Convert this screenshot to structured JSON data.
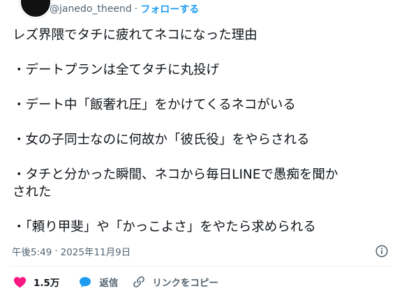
{
  "author": {
    "handle": "@janedo_theend",
    "separator": "·",
    "follow_label": "フォローする"
  },
  "tweet": {
    "lines": [
      "レズ界隈でタチに疲れてネコになった理由",
      "",
      "・デートプランは全てタチに丸投げ",
      "",
      "・デート中「飯奢れ圧」をかけてくるネコがいる",
      "",
      "・女の子同士なのに何故か「彼氏役」をやらされる",
      "",
      "・タチと分かった瞬間、ネコから毎日LINEで愚痴を聞か",
      "された",
      "",
      "・「頼り甲斐」や「かっこよさ」をやたら求められる"
    ]
  },
  "meta": {
    "time": "午後5:49",
    "separator": "·",
    "date": "2025年11月9日"
  },
  "actions": {
    "likes": {
      "icon": "heart-icon",
      "label": "1.5万"
    },
    "reply": {
      "icon": "speech-bubble-icon",
      "label": "返信"
    },
    "copy_link": {
      "icon": "link-icon",
      "label": "リンクをコピー"
    }
  },
  "colors": {
    "accent": "#1d9bf0",
    "like": "#f91880",
    "secondary_text": "#536471",
    "primary_text": "#0f1419"
  }
}
